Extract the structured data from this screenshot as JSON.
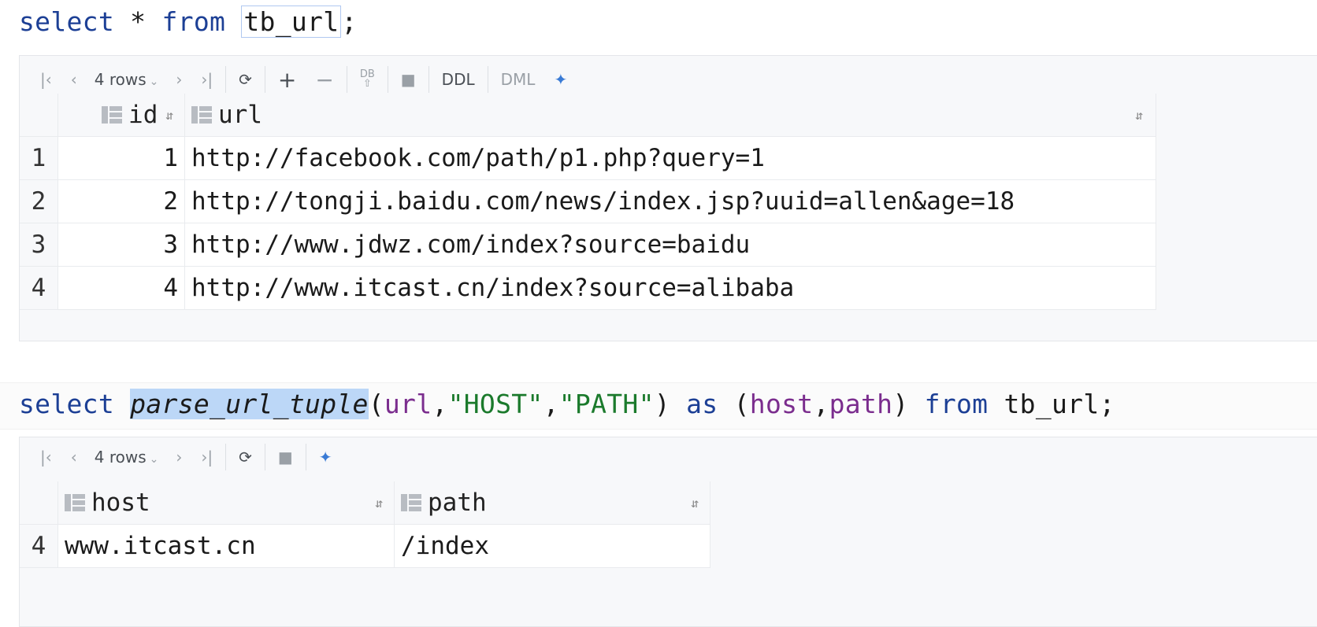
{
  "query1": {
    "kw_select": "select",
    "star": " * ",
    "kw_from": "from",
    "table": "tb_url",
    "semicolon": ";"
  },
  "result1": {
    "toolbar": {
      "rows_label": "4 rows",
      "ddl_label": "DDL",
      "dml_label": "DML"
    },
    "columns": [
      "id",
      "url"
    ],
    "rows": [
      {
        "n": "1",
        "id": "1",
        "url": "http://facebook.com/path/p1.php?query=1"
      },
      {
        "n": "2",
        "id": "2",
        "url": "http://tongji.baidu.com/news/index.jsp?uuid=allen&age=18"
      },
      {
        "n": "3",
        "id": "3",
        "url": "http://www.jdwz.com/index?source=baidu"
      },
      {
        "n": "4",
        "id": "4",
        "url": "http://www.itcast.cn/index?source=alibaba"
      }
    ]
  },
  "query2": {
    "kw_select": "select ",
    "fn": "parse_url_tuple",
    "open": "(",
    "arg1": "url",
    "comma1": ",",
    "str1": "\"HOST\"",
    "comma2": ",",
    "str2": "\"PATH\"",
    "close": ") ",
    "kw_as": "as",
    "open2": " (",
    "arg2": "host",
    "comma3": ",",
    "arg3": "path",
    "close2": ") ",
    "kw_from": "from",
    "table": " tb_url;"
  },
  "result2": {
    "toolbar": {
      "rows_label": "4 rows"
    },
    "columns": [
      "host",
      "path"
    ],
    "rows": [
      {
        "n": "4",
        "host": "www.itcast.cn",
        "path": "/index"
      }
    ]
  }
}
